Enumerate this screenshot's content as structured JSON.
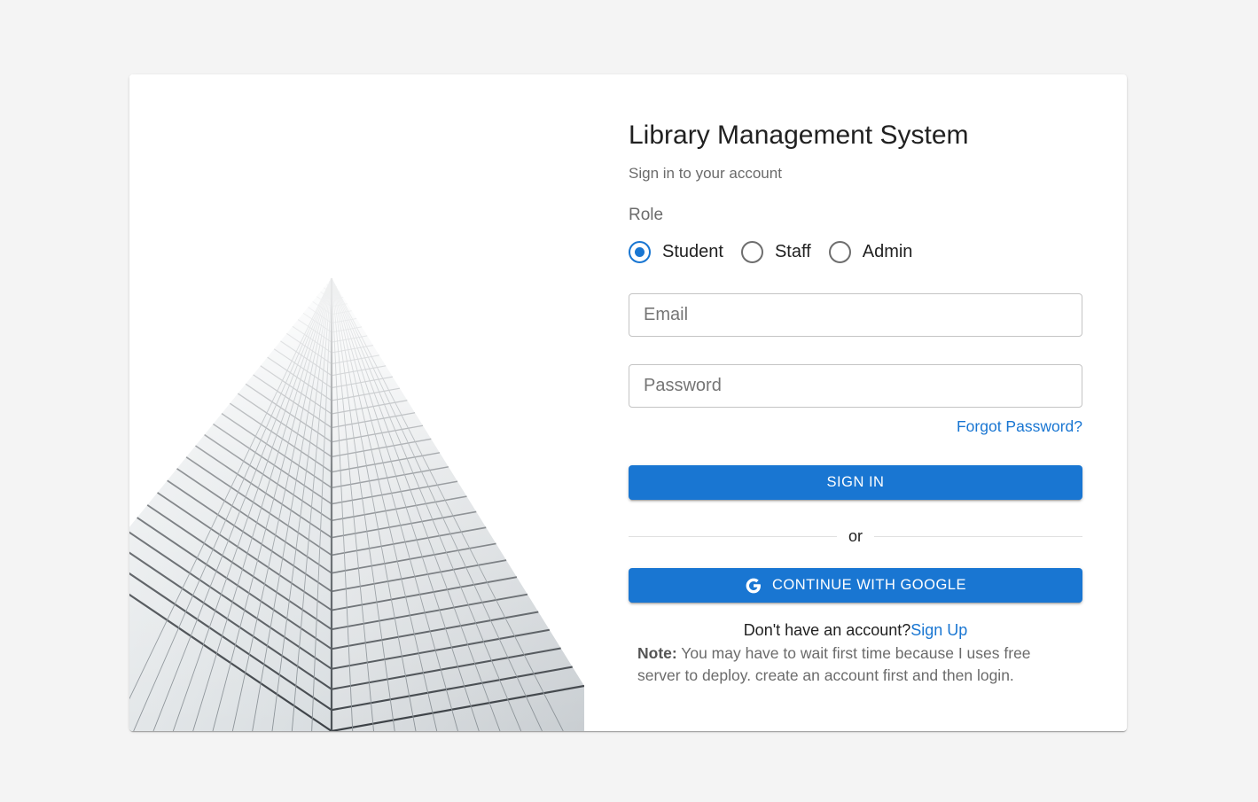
{
  "app": {
    "title": "Library Management System",
    "subtitle": "Sign in to your account"
  },
  "role": {
    "label": "Role",
    "options": [
      "Student",
      "Staff",
      "Admin"
    ],
    "selected": "Student"
  },
  "form": {
    "email_placeholder": "Email",
    "password_placeholder": "Password",
    "forgot_password": "Forgot Password?",
    "sign_in_label": "SIGN IN",
    "divider_text": "or",
    "google_label": "CONTINUE WITH GOOGLE"
  },
  "signup": {
    "prompt": "Don't have an account?",
    "link": "Sign Up"
  },
  "note": {
    "label": "Note:",
    "text": " You may have to wait first time because I uses free server to deploy. create an account first and then login."
  },
  "colors": {
    "primary": "#1976d2",
    "background": "#f4f4f4",
    "card": "#ffffff"
  },
  "icons": {
    "google": "google-g-icon",
    "image": "skyscraper-photo"
  }
}
